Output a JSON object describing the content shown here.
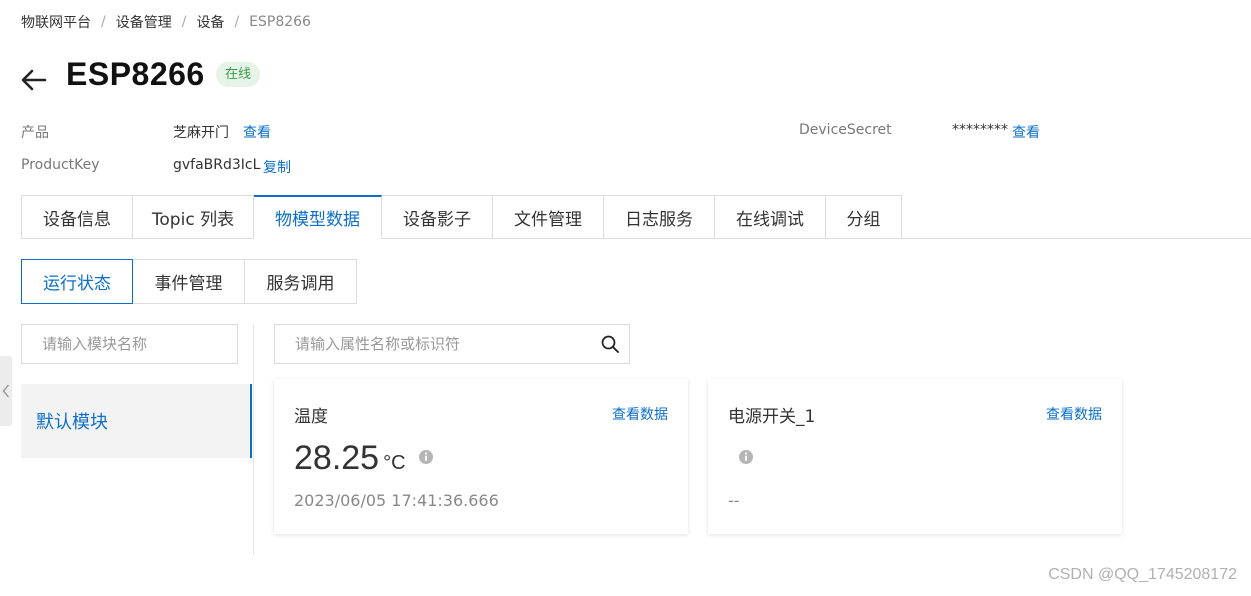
{
  "breadcrumb": {
    "items": [
      "物联网平台",
      "设备管理",
      "设备"
    ],
    "current": "ESP8266",
    "separator": "/"
  },
  "header": {
    "title": "ESP8266",
    "status": "在线"
  },
  "info": {
    "product_label": "产品",
    "product_value": "芝麻开门",
    "product_link": "查看",
    "productkey_label": "ProductKey",
    "productkey_value": "gvfaBRd3IcL",
    "productkey_link": "复制",
    "secret_label": "DeviceSecret",
    "secret_value": "********",
    "secret_link": "查看"
  },
  "tabs": [
    {
      "label": "设备信息",
      "active": false
    },
    {
      "label": "Topic 列表",
      "active": false
    },
    {
      "label": "物模型数据",
      "active": true
    },
    {
      "label": "设备影子",
      "active": false
    },
    {
      "label": "文件管理",
      "active": false
    },
    {
      "label": "日志服务",
      "active": false
    },
    {
      "label": "在线调试",
      "active": false
    },
    {
      "label": "分组",
      "active": false
    }
  ],
  "sub_tabs": [
    {
      "label": "运行状态",
      "active": true
    },
    {
      "label": "事件管理",
      "active": false
    },
    {
      "label": "服务调用",
      "active": false
    }
  ],
  "module_search": {
    "placeholder": "请输入模块名称"
  },
  "property_search": {
    "placeholder": "请输入属性名称或标识符"
  },
  "modules": [
    {
      "label": "默认模块",
      "active": true
    }
  ],
  "cards": [
    {
      "name": "温度",
      "link": "查看数据",
      "value": "28.25",
      "unit": "°C",
      "time": "2023/06/05 17:41:36.666"
    },
    {
      "name": "电源开关_1",
      "link": "查看数据",
      "value": "",
      "unit": "",
      "time": "--"
    }
  ],
  "watermark": "CSDN @QQ_1745208172",
  "colors": {
    "accent": "#0d6fc9",
    "online_text": "#3a9b4d",
    "online_bg": "#e6f4e8"
  },
  "icons": {
    "back": "arrow-left-icon",
    "search": "search-icon",
    "info": "info-icon",
    "collapse": "chevron-left-icon"
  }
}
